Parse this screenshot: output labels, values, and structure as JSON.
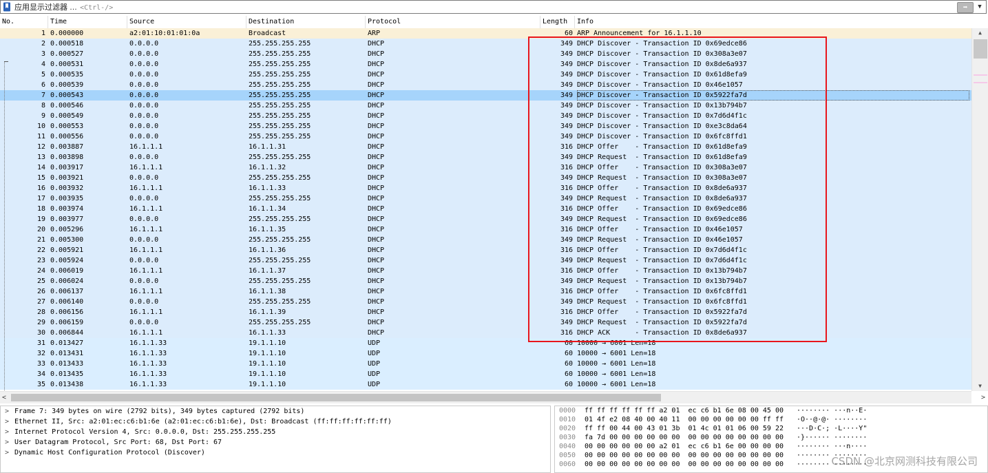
{
  "filter": {
    "label": "应用显示过滤器 …",
    "placeholder": "<Ctrl-/>",
    "apply_icon": "arrow-right-icon",
    "dropdown_icon": "chevron-down-icon"
  },
  "columns": {
    "no": "No.",
    "time": "Time",
    "source": "Source",
    "destination": "Destination",
    "protocol": "Protocol",
    "length": "Length",
    "info": "Info"
  },
  "packets": [
    {
      "no": "1",
      "time": "0.000000",
      "src": "a2:01:10:01:01:0a",
      "dst": "Broadcast",
      "proto": "ARP",
      "len": "60",
      "info": "ARP Announcement for 16.1.1.10"
    },
    {
      "no": "2",
      "time": "0.000518",
      "src": "0.0.0.0",
      "dst": "255.255.255.255",
      "proto": "DHCP",
      "len": "349",
      "info": "DHCP Discover - Transaction ID 0x69edce86"
    },
    {
      "no": "3",
      "time": "0.000527",
      "src": "0.0.0.0",
      "dst": "255.255.255.255",
      "proto": "DHCP",
      "len": "349",
      "info": "DHCP Discover - Transaction ID 0x308a3e07"
    },
    {
      "no": "4",
      "time": "0.000531",
      "src": "0.0.0.0",
      "dst": "255.255.255.255",
      "proto": "DHCP",
      "len": "349",
      "info": "DHCP Discover - Transaction ID 0x8de6a937"
    },
    {
      "no": "5",
      "time": "0.000535",
      "src": "0.0.0.0",
      "dst": "255.255.255.255",
      "proto": "DHCP",
      "len": "349",
      "info": "DHCP Discover - Transaction ID 0x61d8efa9"
    },
    {
      "no": "6",
      "time": "0.000539",
      "src": "0.0.0.0",
      "dst": "255.255.255.255",
      "proto": "DHCP",
      "len": "349",
      "info": "DHCP Discover - Transaction ID 0x46e1057"
    },
    {
      "no": "7",
      "time": "0.000543",
      "src": "0.0.0.0",
      "dst": "255.255.255.255",
      "proto": "DHCP",
      "len": "349",
      "info": "DHCP Discover - Transaction ID 0x5922fa7d"
    },
    {
      "no": "8",
      "time": "0.000546",
      "src": "0.0.0.0",
      "dst": "255.255.255.255",
      "proto": "DHCP",
      "len": "349",
      "info": "DHCP Discover - Transaction ID 0x13b794b7"
    },
    {
      "no": "9",
      "time": "0.000549",
      "src": "0.0.0.0",
      "dst": "255.255.255.255",
      "proto": "DHCP",
      "len": "349",
      "info": "DHCP Discover - Transaction ID 0x7d6d4f1c"
    },
    {
      "no": "10",
      "time": "0.000553",
      "src": "0.0.0.0",
      "dst": "255.255.255.255",
      "proto": "DHCP",
      "len": "349",
      "info": "DHCP Discover - Transaction ID 0xe3c8da64"
    },
    {
      "no": "11",
      "time": "0.000556",
      "src": "0.0.0.0",
      "dst": "255.255.255.255",
      "proto": "DHCP",
      "len": "349",
      "info": "DHCP Discover - Transaction ID 0x6fc8ffd1"
    },
    {
      "no": "12",
      "time": "0.003887",
      "src": "16.1.1.1",
      "dst": "16.1.1.31",
      "proto": "DHCP",
      "len": "316",
      "info": "DHCP Offer    - Transaction ID 0x61d8efa9"
    },
    {
      "no": "13",
      "time": "0.003898",
      "src": "0.0.0.0",
      "dst": "255.255.255.255",
      "proto": "DHCP",
      "len": "349",
      "info": "DHCP Request  - Transaction ID 0x61d8efa9"
    },
    {
      "no": "14",
      "time": "0.003917",
      "src": "16.1.1.1",
      "dst": "16.1.1.32",
      "proto": "DHCP",
      "len": "316",
      "info": "DHCP Offer    - Transaction ID 0x308a3e07"
    },
    {
      "no": "15",
      "time": "0.003921",
      "src": "0.0.0.0",
      "dst": "255.255.255.255",
      "proto": "DHCP",
      "len": "349",
      "info": "DHCP Request  - Transaction ID 0x308a3e07"
    },
    {
      "no": "16",
      "time": "0.003932",
      "src": "16.1.1.1",
      "dst": "16.1.1.33",
      "proto": "DHCP",
      "len": "316",
      "info": "DHCP Offer    - Transaction ID 0x8de6a937"
    },
    {
      "no": "17",
      "time": "0.003935",
      "src": "0.0.0.0",
      "dst": "255.255.255.255",
      "proto": "DHCP",
      "len": "349",
      "info": "DHCP Request  - Transaction ID 0x8de6a937"
    },
    {
      "no": "18",
      "time": "0.003974",
      "src": "16.1.1.1",
      "dst": "16.1.1.34",
      "proto": "DHCP",
      "len": "316",
      "info": "DHCP Offer    - Transaction ID 0x69edce86"
    },
    {
      "no": "19",
      "time": "0.003977",
      "src": "0.0.0.0",
      "dst": "255.255.255.255",
      "proto": "DHCP",
      "len": "349",
      "info": "DHCP Request  - Transaction ID 0x69edce86"
    },
    {
      "no": "20",
      "time": "0.005296",
      "src": "16.1.1.1",
      "dst": "16.1.1.35",
      "proto": "DHCP",
      "len": "316",
      "info": "DHCP Offer    - Transaction ID 0x46e1057"
    },
    {
      "no": "21",
      "time": "0.005300",
      "src": "0.0.0.0",
      "dst": "255.255.255.255",
      "proto": "DHCP",
      "len": "349",
      "info": "DHCP Request  - Transaction ID 0x46e1057"
    },
    {
      "no": "22",
      "time": "0.005921",
      "src": "16.1.1.1",
      "dst": "16.1.1.36",
      "proto": "DHCP",
      "len": "316",
      "info": "DHCP Offer    - Transaction ID 0x7d6d4f1c"
    },
    {
      "no": "23",
      "time": "0.005924",
      "src": "0.0.0.0",
      "dst": "255.255.255.255",
      "proto": "DHCP",
      "len": "349",
      "info": "DHCP Request  - Transaction ID 0x7d6d4f1c"
    },
    {
      "no": "24",
      "time": "0.006019",
      "src": "16.1.1.1",
      "dst": "16.1.1.37",
      "proto": "DHCP",
      "len": "316",
      "info": "DHCP Offer    - Transaction ID 0x13b794b7"
    },
    {
      "no": "25",
      "time": "0.006024",
      "src": "0.0.0.0",
      "dst": "255.255.255.255",
      "proto": "DHCP",
      "len": "349",
      "info": "DHCP Request  - Transaction ID 0x13b794b7"
    },
    {
      "no": "26",
      "time": "0.006137",
      "src": "16.1.1.1",
      "dst": "16.1.1.38",
      "proto": "DHCP",
      "len": "316",
      "info": "DHCP Offer    - Transaction ID 0x6fc8ffd1"
    },
    {
      "no": "27",
      "time": "0.006140",
      "src": "0.0.0.0",
      "dst": "255.255.255.255",
      "proto": "DHCP",
      "len": "349",
      "info": "DHCP Request  - Transaction ID 0x6fc8ffd1"
    },
    {
      "no": "28",
      "time": "0.006156",
      "src": "16.1.1.1",
      "dst": "16.1.1.39",
      "proto": "DHCP",
      "len": "316",
      "info": "DHCP Offer    - Transaction ID 0x5922fa7d"
    },
    {
      "no": "29",
      "time": "0.006159",
      "src": "0.0.0.0",
      "dst": "255.255.255.255",
      "proto": "DHCP",
      "len": "349",
      "info": "DHCP Request  - Transaction ID 0x5922fa7d"
    },
    {
      "no": "30",
      "time": "0.006844",
      "src": "16.1.1.1",
      "dst": "16.1.1.33",
      "proto": "DHCP",
      "len": "316",
      "info": "DHCP ACK      - Transaction ID 0x8de6a937"
    },
    {
      "no": "31",
      "time": "0.013427",
      "src": "16.1.1.33",
      "dst": "19.1.1.10",
      "proto": "UDP",
      "len": "60",
      "info": "10000 → 6001 Len=18"
    },
    {
      "no": "32",
      "time": "0.013431",
      "src": "16.1.1.33",
      "dst": "19.1.1.10",
      "proto": "UDP",
      "len": "60",
      "info": "10000 → 6001 Len=18"
    },
    {
      "no": "33",
      "time": "0.013433",
      "src": "16.1.1.33",
      "dst": "19.1.1.10",
      "proto": "UDP",
      "len": "60",
      "info": "10000 → 6001 Len=18"
    },
    {
      "no": "34",
      "time": "0.013435",
      "src": "16.1.1.33",
      "dst": "19.1.1.10",
      "proto": "UDP",
      "len": "60",
      "info": "10000 → 6001 Len=18"
    },
    {
      "no": "35",
      "time": "0.013438",
      "src": "16.1.1.33",
      "dst": "19.1.1.10",
      "proto": "UDP",
      "len": "60",
      "info": "10000 → 6001 Len=18"
    }
  ],
  "selected_packet": "7",
  "row_colors": {
    "arp": "#faf0d7",
    "dhcp": "#dcecfc",
    "udp": "#daeeff",
    "selected": "#a6d4fb",
    "highlight_box": "#e8151b"
  },
  "details": [
    "Frame 7: 349 bytes on wire (2792 bits), 349 bytes captured (2792 bits)",
    "Ethernet II, Src: a2:01:ec:c6:b1:6e (a2:01:ec:c6:b1:6e), Dst: Broadcast (ff:ff:ff:ff:ff:ff)",
    "Internet Protocol Version 4, Src: 0.0.0.0, Dst: 255.255.255.255",
    "User Datagram Protocol, Src Port: 68, Dst Port: 67",
    "Dynamic Host Configuration Protocol (Discover)"
  ],
  "bytes": [
    {
      "off": "0000",
      "hex": "ff ff ff ff ff ff a2 01  ec c6 b1 6e 08 00 45 00",
      "ascii": "········ ···n··E·"
    },
    {
      "off": "0010",
      "hex": "01 4f e2 08 40 00 40 11  00 00 00 00 00 00 ff ff",
      "ascii": "·O··@·@· ········"
    },
    {
      "off": "0020",
      "hex": "ff ff 00 44 00 43 01 3b  01 4c 01 01 06 00 59 22",
      "ascii": "···D·C·; ·L····Y\""
    },
    {
      "off": "0030",
      "hex": "fa 7d 00 00 00 00 00 00  00 00 00 00 00 00 00 00",
      "ascii": "·}······ ········"
    },
    {
      "off": "0040",
      "hex": "00 00 00 00 00 00 a2 01  ec c6 b1 6e 00 00 00 00",
      "ascii": "········ ···n····"
    },
    {
      "off": "0050",
      "hex": "00 00 00 00 00 00 00 00  00 00 00 00 00 00 00 00",
      "ascii": "········ ········"
    },
    {
      "off": "0060",
      "hex": "00 00 00 00 00 00 00 00  00 00 00 00 00 00 00 00",
      "ascii": "········ ········"
    }
  ],
  "watermark": "CSDN @北京网测科技有限公司"
}
